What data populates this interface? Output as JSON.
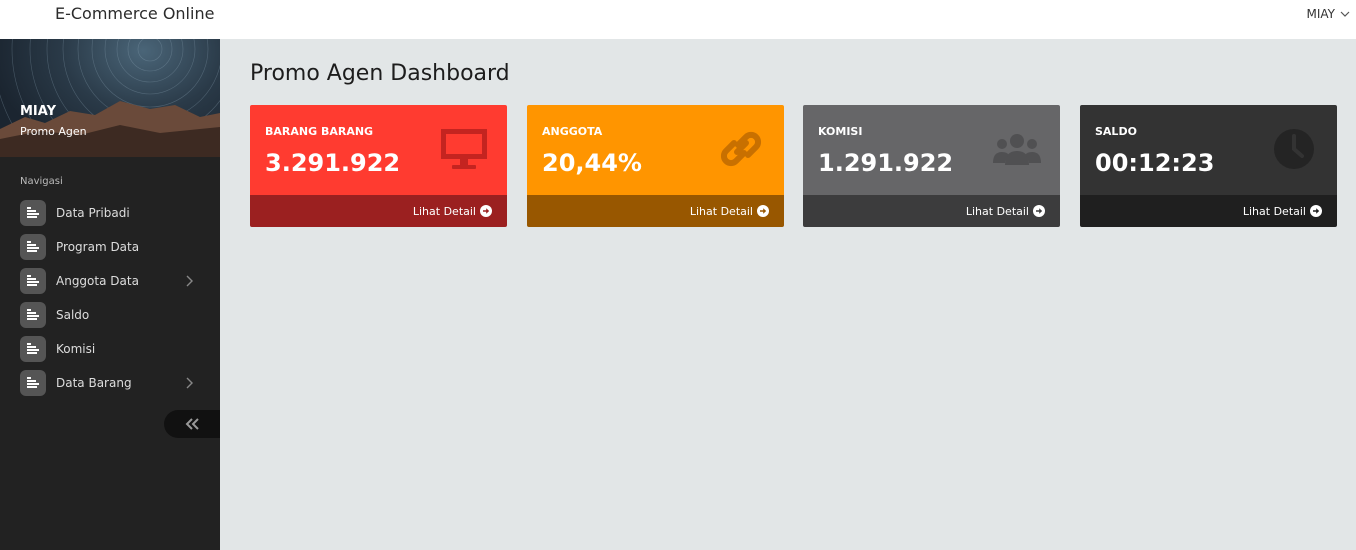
{
  "header": {
    "brand": "E-Commerce Online",
    "user": "MIAY"
  },
  "sidebar": {
    "profile": {
      "name": "MIAY",
      "role": "Promo Agen"
    },
    "nav_heading": "Navigasi",
    "items": [
      {
        "label": "Data Pribadi",
        "icon": "list-icon",
        "has_submenu": false
      },
      {
        "label": "Program Data",
        "icon": "list-icon",
        "has_submenu": false
      },
      {
        "label": "Anggota Data",
        "icon": "list-icon",
        "has_submenu": true
      },
      {
        "label": "Saldo",
        "icon": "list-icon",
        "has_submenu": false
      },
      {
        "label": "Komisi",
        "icon": "list-icon",
        "has_submenu": false
      },
      {
        "label": "Data Barang",
        "icon": "list-icon",
        "has_submenu": true
      }
    ],
    "collapse_icon": "double-chevron-left-icon"
  },
  "main": {
    "title": "Promo Agen Dashboard",
    "cards": [
      {
        "label": "BARANG BARANG",
        "value": "3.291.922",
        "link": "Lihat Detail",
        "icon": "monitor-icon",
        "color": "#ff3b30",
        "footer_color": "#9b2020"
      },
      {
        "label": "ANGGOTA",
        "value": "20,44%",
        "link": "Lihat Detail",
        "icon": "link-icon",
        "color": "#ff9500",
        "footer_color": "#985700"
      },
      {
        "label": "KOMISI",
        "value": "1.291.922",
        "link": "Lihat Detail",
        "icon": "users-icon",
        "color": "#666668",
        "footer_color": "#3c3c3d"
      },
      {
        "label": "SALDO",
        "value": "00:12:23",
        "link": "Lihat Detail",
        "icon": "clock-icon",
        "color": "#333333",
        "footer_color": "#1f1f1f"
      }
    ]
  }
}
